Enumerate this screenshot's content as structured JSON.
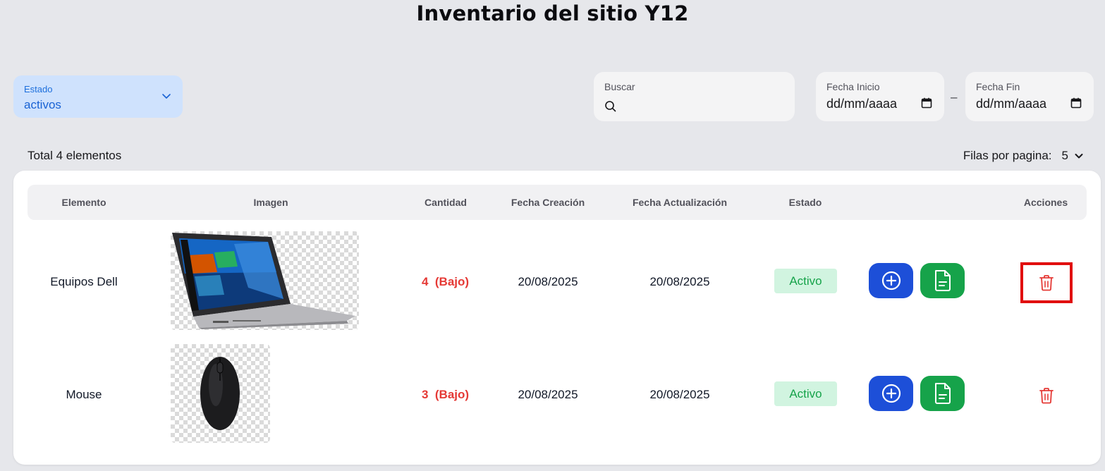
{
  "page_title": "Inventario del sitio Y12",
  "filters": {
    "estado": {
      "label": "Estado",
      "value": "activos"
    },
    "search": {
      "label": "Buscar",
      "placeholder": ""
    },
    "fecha_inicio": {
      "label": "Fecha Inicio",
      "value": "dd/mm/aaaa"
    },
    "fecha_fin": {
      "label": "Fecha Fin",
      "value": "dd/mm/aaaa"
    },
    "range_separator": "–"
  },
  "summary": {
    "total_text": "Total 4 elementos",
    "rows_per_page_label": "Filas por pagina:",
    "rows_per_page_value": "5"
  },
  "table": {
    "columns": [
      "Elemento",
      "Imagen",
      "Cantidad",
      "Fecha Creación",
      "Fecha Actualización",
      "Estado",
      "Acciones"
    ],
    "rows": [
      {
        "elemento": "Equipos Dell",
        "cantidad": "4",
        "nivel": "(Bajo)",
        "fecha_creacion": "20/08/2025",
        "fecha_actualizacion": "20/08/2025",
        "estado": "Activo",
        "image": "laptop-image"
      },
      {
        "elemento": "Mouse",
        "cantidad": "3",
        "nivel": "(Bajo)",
        "fecha_creacion": "20/08/2025",
        "fecha_actualizacion": "20/08/2025",
        "estado": "Activo",
        "image": "mouse-image"
      }
    ]
  },
  "colors": {
    "background": "#e6e7eb",
    "estado_select": "#cfe2fd",
    "add_button": "#1d4fd8",
    "doc_button": "#16a34a",
    "low_stock": "#e53935",
    "status_active_bg": "#d1f4e0",
    "status_active_text": "#16a34a",
    "highlight": "#e10e0e"
  },
  "icons": [
    "chevron-down-icon",
    "search-icon",
    "calendar-icon",
    "plus-circle-icon",
    "document-icon",
    "trash-icon"
  ]
}
